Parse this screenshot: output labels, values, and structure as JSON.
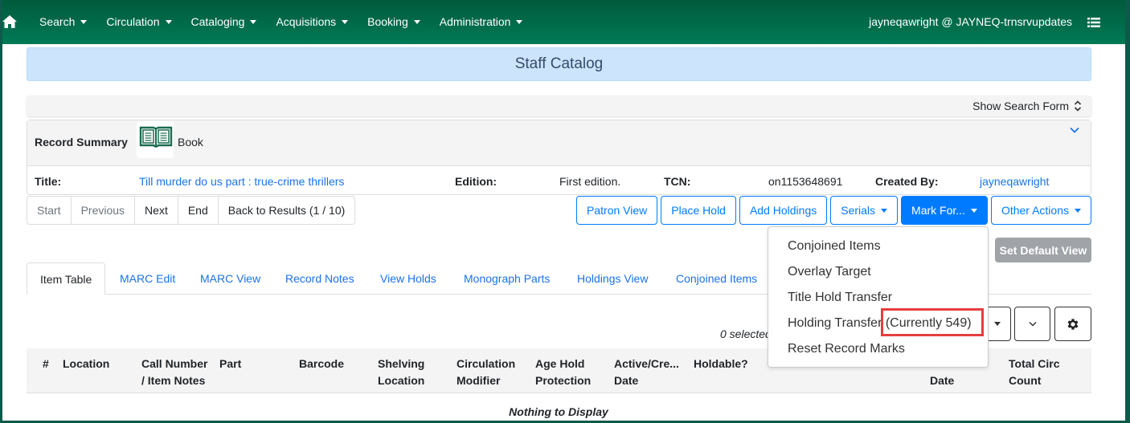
{
  "navbar": {
    "home_icon": "home-icon",
    "menu": [
      {
        "label": "Search"
      },
      {
        "label": "Circulation"
      },
      {
        "label": "Cataloging"
      },
      {
        "label": "Acquisitions"
      },
      {
        "label": "Booking"
      },
      {
        "label": "Administration"
      }
    ],
    "user": "jayneqawright @ JAYNEQ-trnsrvupdates",
    "menu_icon": "list-icon"
  },
  "banner": {
    "title": "Staff Catalog"
  },
  "search_bar": {
    "toggle_label": "Show Search Form"
  },
  "record_summary": {
    "heading": "Record Summary",
    "format_icon": "book-icon",
    "format": "Book",
    "title_label": "Title:",
    "title_value": "Till murder do us part : true-crime thrillers",
    "edition_label": "Edition:",
    "edition_value": "First edition.",
    "tcn_label": "TCN:",
    "tcn_value": "on1153648691",
    "created_by_label": "Created By:",
    "created_by_value": "jayneqawright"
  },
  "pager": {
    "start": "Start",
    "previous": "Previous",
    "next": "Next",
    "end": "End",
    "back": "Back to Results (1 / 10)"
  },
  "actions": {
    "patron_view": "Patron View",
    "place_hold": "Place Hold",
    "add_holdings": "Add Holdings",
    "serials": "Serials",
    "mark_for": "Mark For...",
    "other_actions": "Other Actions",
    "set_default_view": "Set Default View"
  },
  "mark_for_menu": [
    {
      "label": "Conjoined Items"
    },
    {
      "label": "Overlay Target"
    },
    {
      "label": "Title Hold Transfer"
    },
    {
      "label": "Holding Transfer",
      "suffix": "(Currently 549)"
    },
    {
      "label": "Reset Record Marks"
    }
  ],
  "tabs": [
    {
      "label": "Item Table",
      "active": true
    },
    {
      "label": "MARC Edit"
    },
    {
      "label": "MARC View"
    },
    {
      "label": "Record Notes"
    },
    {
      "label": "View Holds"
    },
    {
      "label": "Monograph Parts"
    },
    {
      "label": "Holdings View"
    },
    {
      "label": "Conjoined Items"
    }
  ],
  "grid": {
    "selected_text": "0 selected",
    "columns": [
      "#",
      "Location",
      "Call Number / Item Notes",
      "Part",
      "Barcode",
      "Shelving Location",
      "Circulation Modifier",
      "Age Hold Protection",
      "Active/Cre... Date",
      "Holdable?",
      "Date",
      "Total Circ Count"
    ],
    "col_lines": [
      [
        "#"
      ],
      [
        "Location"
      ],
      [
        "Call Number",
        "/ Item Notes"
      ],
      [
        "Part"
      ],
      [
        "Barcode"
      ],
      [
        "Shelving",
        "Location"
      ],
      [
        "Circulation",
        "Modifier"
      ],
      [
        "Age Hold",
        "Protection"
      ],
      [
        "Active/Cre...",
        "Date"
      ],
      [
        "Holdable?"
      ],
      [
        "",
        "Date"
      ],
      [
        "Total Circ",
        "Count"
      ]
    ],
    "empty_text": "Nothing to Display"
  }
}
